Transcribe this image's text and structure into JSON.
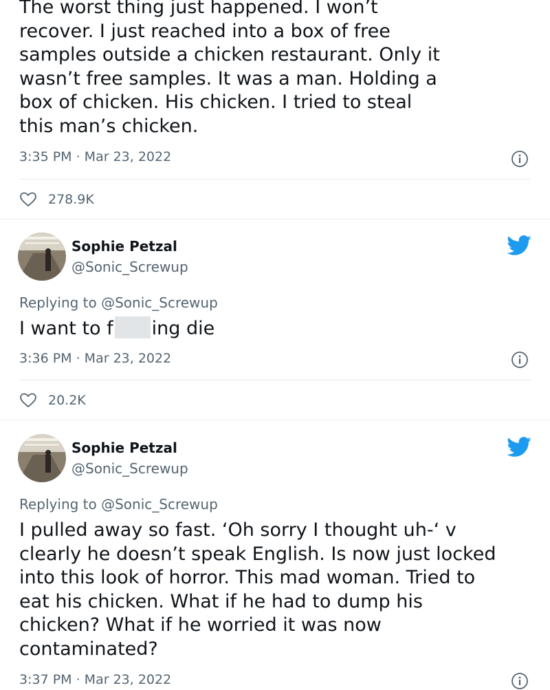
{
  "tweet1": {
    "text": "The worst thing just happened. I won’t\nrecover. I just reached into a box of free\nsamples outside a chicken restaurant. Only it\nwasn’t free samples. It was a man. Holding a\nbox of chicken. His chicken. I tried to steal\nthis man’s chicken.",
    "timestamp": "3:35 PM · Mar 23, 2022",
    "likes": "278.9K"
  },
  "tweet2": {
    "author_name": "Sophie Petzal",
    "author_handle": "@Sonic_Screwup",
    "replying_to": "Replying to @Sonic_Screwup",
    "text_before": "I want to f",
    "text_after": "ing die",
    "timestamp": "3:36 PM · Mar 23, 2022",
    "likes": "20.2K"
  },
  "tweet3": {
    "author_name": "Sophie Petzal",
    "author_handle": "@Sonic_Screwup",
    "replying_to": "Replying to @Sonic_Screwup",
    "text": "I pulled away so fast. ‘Oh sorry I thought uh-‘ v\nclearly he doesn’t speak English. Is now just locked\ninto this look of horror. This mad woman. Tried to\neat his chicken. What if he had to dump his\nchicken? What if he worried it was now\ncontaminated?",
    "timestamp": "3:37 PM · Mar 23, 2022"
  },
  "colors": {
    "twitter_blue": "#1d9bf0",
    "text_primary": "#0f1419",
    "text_secondary": "#536471",
    "divider": "#e6ecf0"
  },
  "icons": {
    "bird": "twitter-bird-icon",
    "heart": "heart-icon",
    "info": "info-icon"
  }
}
